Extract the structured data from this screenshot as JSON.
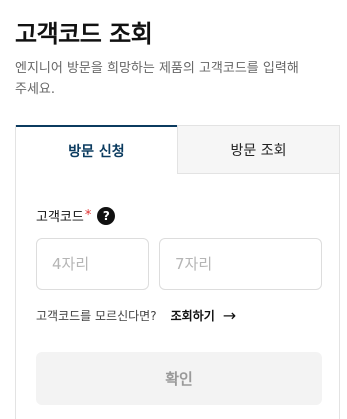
{
  "header": {
    "title": "고객코드 조회",
    "description": "엔지니어 방문을 희망하는 제품의 고객코드를 입력해 주세요."
  },
  "tabs": [
    {
      "label": "방문 신청",
      "active": true
    },
    {
      "label": "방문 조회",
      "active": false
    }
  ],
  "form": {
    "label": "고객코드",
    "required_mark": "*",
    "help_icon": "?",
    "input_short_placeholder": "4자리",
    "input_long_placeholder": "7자리",
    "hint_text": "고객코드를 모르신다면?",
    "hint_link": "조회하기",
    "hint_arrow": "→",
    "confirm_label": "확인"
  },
  "colors": {
    "accent": "#0b3b5f",
    "required": "#e03030",
    "button_bg": "#f3f3f3",
    "button_text": "#9a9a9a"
  }
}
